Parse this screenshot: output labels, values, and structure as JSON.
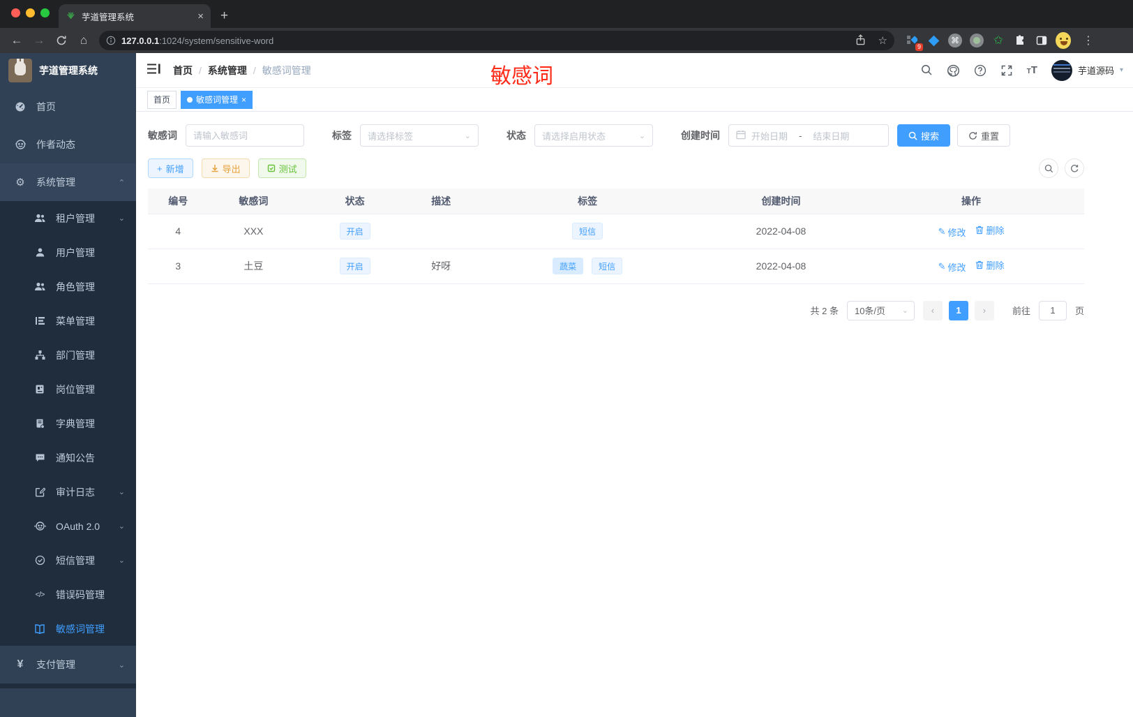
{
  "colors": {
    "accent": "#409eff",
    "annotation_red": "#fe2c19",
    "warning": "#e6a23c",
    "success": "#67c23a",
    "sidebar_bg": "#304156",
    "submenu_bg": "#1f2d3d"
  },
  "browser": {
    "tab_title": "芋道管理系统",
    "url_host": "127.0.0.1",
    "url_rest": ":1024/system/sensitive-word",
    "extension_badge": "9"
  },
  "sidebar": {
    "logo_title": "芋道管理系统",
    "top_items": [
      {
        "label": "首页"
      },
      {
        "label": "作者动态"
      }
    ],
    "section_label": "系统管理",
    "submenu": [
      {
        "label": "租户管理"
      },
      {
        "label": "用户管理"
      },
      {
        "label": "角色管理"
      },
      {
        "label": "菜单管理"
      },
      {
        "label": "部门管理"
      },
      {
        "label": "岗位管理"
      },
      {
        "label": "字典管理"
      },
      {
        "label": "通知公告"
      },
      {
        "label": "审计日志"
      },
      {
        "label": "OAuth 2.0"
      },
      {
        "label": "短信管理"
      },
      {
        "label": "错误码管理"
      },
      {
        "label": "敏感词管理"
      }
    ],
    "bottom_item": "支付管理"
  },
  "header": {
    "breadcrumb": [
      "首页",
      "系统管理",
      "敏感词管理"
    ],
    "annotation": "敏感词",
    "username": "芋道源码"
  },
  "tagsview": {
    "home": "首页",
    "active": "敏感词管理"
  },
  "filters": {
    "keyword_label": "敏感词",
    "keyword_placeholder": "请输入敏感词",
    "tag_label": "标签",
    "tag_placeholder": "请选择标签",
    "status_label": "状态",
    "status_placeholder": "请选择启用状态",
    "date_label": "创建时间",
    "date_start": "开始日期",
    "date_sep": "-",
    "date_end": "结束日期",
    "search_label": "搜索",
    "reset_label": "重置"
  },
  "toolbar": {
    "add_label": "新增",
    "export_label": "导出",
    "test_label": "测试"
  },
  "table": {
    "headers": [
      "编号",
      "敏感词",
      "状态",
      "描述",
      "标签",
      "创建时间",
      "操作"
    ],
    "actions": {
      "edit": "修改",
      "delete": "删除"
    },
    "rows": [
      {
        "id": "4",
        "word": "XXX",
        "status": "开启",
        "desc": "",
        "tags": [
          "短信"
        ],
        "created": "2022-04-08"
      },
      {
        "id": "3",
        "word": "土豆",
        "status": "开启",
        "desc": "好呀",
        "tags": [
          "蔬菜",
          "短信"
        ],
        "created": "2022-04-08"
      }
    ]
  },
  "pagination": {
    "total": "共 2 条",
    "page_size": "10条/页",
    "current_page": "1",
    "goto_label": "前往",
    "goto_value": "1",
    "page_unit": "页"
  }
}
